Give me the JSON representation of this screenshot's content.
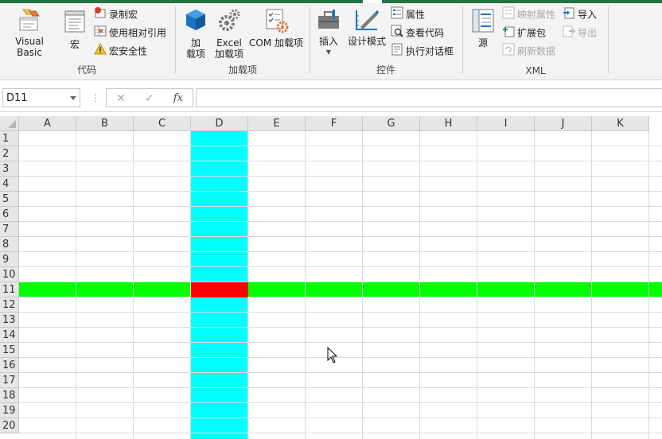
{
  "ribbon": {
    "code_group": {
      "label": "代码",
      "visual_basic": "Visual Basic",
      "macros": "宏",
      "record_macro": "录制宏",
      "relative_refs": "使用相对引用",
      "macro_security": "宏安全性"
    },
    "addins_group": {
      "label": "加载项",
      "addins_line1": "加",
      "addins_line2": "载项",
      "excel_addins_line1": "Excel",
      "excel_addins_line2": "加载项",
      "com_addins": "COM 加载项"
    },
    "controls_group": {
      "label": "控件",
      "insert": "插入",
      "design_mode": "设计模式",
      "properties": "属性",
      "view_code": "查看代码",
      "run_dialog": "执行对话框"
    },
    "xml_group": {
      "label": "XML",
      "source": "源",
      "map_properties": "映射属性",
      "expansion_packs": "扩展包",
      "refresh_data": "刷新数据",
      "import": "导入",
      "export": "导出"
    }
  },
  "formula_bar": {
    "name_box": "D11",
    "dots": "⋮",
    "cancel": "✕",
    "enter": "✓",
    "fx": "fx",
    "formula": ""
  },
  "sheet": {
    "columns": [
      "A",
      "B",
      "C",
      "D",
      "E",
      "F",
      "G",
      "H",
      "I",
      "J",
      "K"
    ],
    "rows": [
      "1",
      "2",
      "3",
      "4",
      "5",
      "6",
      "7",
      "8",
      "9",
      "10",
      "11",
      "12",
      "13",
      "14",
      "15",
      "16",
      "17",
      "18",
      "19",
      "20"
    ],
    "active_cell": "D11",
    "highlight_column": "D",
    "highlight_row": "11",
    "colors": {
      "column_fill": "#00FFFF",
      "row_fill": "#00FF00",
      "active_fill": "#FF0000",
      "accent": "#217346"
    }
  }
}
